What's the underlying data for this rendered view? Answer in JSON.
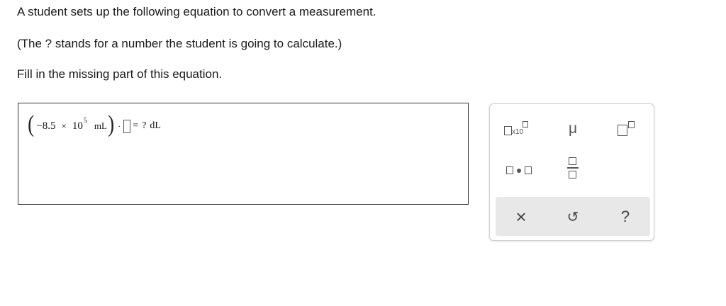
{
  "prompts": [
    "A student sets up the following equation to convert a measurement.",
    "(The ? stands for a number the student is going to calculate.)",
    "Fill in the missing part of this equation."
  ],
  "equation": {
    "open_paren": "(",
    "value": "−8.5",
    "times": "×",
    "base": "10",
    "exponent": "5",
    "unit": "mL",
    "close_paren": ")",
    "dot": "·",
    "equals": "=",
    "unknown": "?",
    "result_unit": "dL"
  },
  "palette": {
    "buttons": [
      {
        "name": "scientific-notation-button",
        "icon": "x10-icon",
        "label": "x10"
      },
      {
        "name": "micro-symbol-button",
        "icon": "mu-icon",
        "label": "μ"
      },
      {
        "name": "superscript-button",
        "icon": "superscript-icon"
      },
      {
        "name": "multiply-dot-button",
        "icon": "multiply-dot-icon"
      },
      {
        "name": "fraction-button",
        "icon": "fraction-icon"
      }
    ],
    "actions": {
      "clear": "×",
      "undo": "↺",
      "help": "?"
    }
  },
  "colors": {
    "border": "#333333",
    "palette_border": "#cfcfcf",
    "action_bar": "#e8e8e8",
    "icon": "#555555"
  }
}
